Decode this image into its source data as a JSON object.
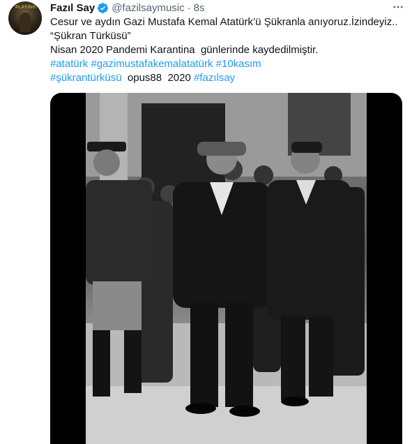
{
  "tweet": {
    "author_name": "Fazıl Say",
    "handle": "@fazilsaymusic",
    "separator": "·",
    "time": "8s",
    "avatar_text": "PLAYING",
    "lines": [
      [
        {
          "text": "Cesur ve aydın Gazi Mustafa Kemal Atatürk’ü Şükranla anıyoruz.İzindeyiz..",
          "tag": false
        }
      ],
      [
        {
          "text": "“Şükran Türküsü”",
          "tag": false
        }
      ],
      [
        {
          "text": "Nisan 2020 Pandemi Karantina  günlerinde kaydedilmiştir.",
          "tag": false
        }
      ],
      [
        {
          "text": "#atatürk",
          "tag": true
        },
        {
          "text": " ",
          "tag": false
        },
        {
          "text": "#gazimustafakemalatatürk",
          "tag": true
        },
        {
          "text": " ",
          "tag": false
        },
        {
          "text": "#10kasım",
          "tag": true
        }
      ],
      [
        {
          "text": "#şükrantürküsü",
          "tag": true
        },
        {
          "text": "  opus88  2020 ",
          "tag": false
        },
        {
          "text": "#fazılsay",
          "tag": true
        }
      ]
    ]
  },
  "colors": {
    "text": "#0f1419",
    "secondary": "#536471",
    "link": "#1d9bf0",
    "verified": "#1d9bf0",
    "media_bg": "#000000"
  },
  "icons": {
    "verified": "verified-badge-icon",
    "more": "more-horizontal-icon"
  }
}
